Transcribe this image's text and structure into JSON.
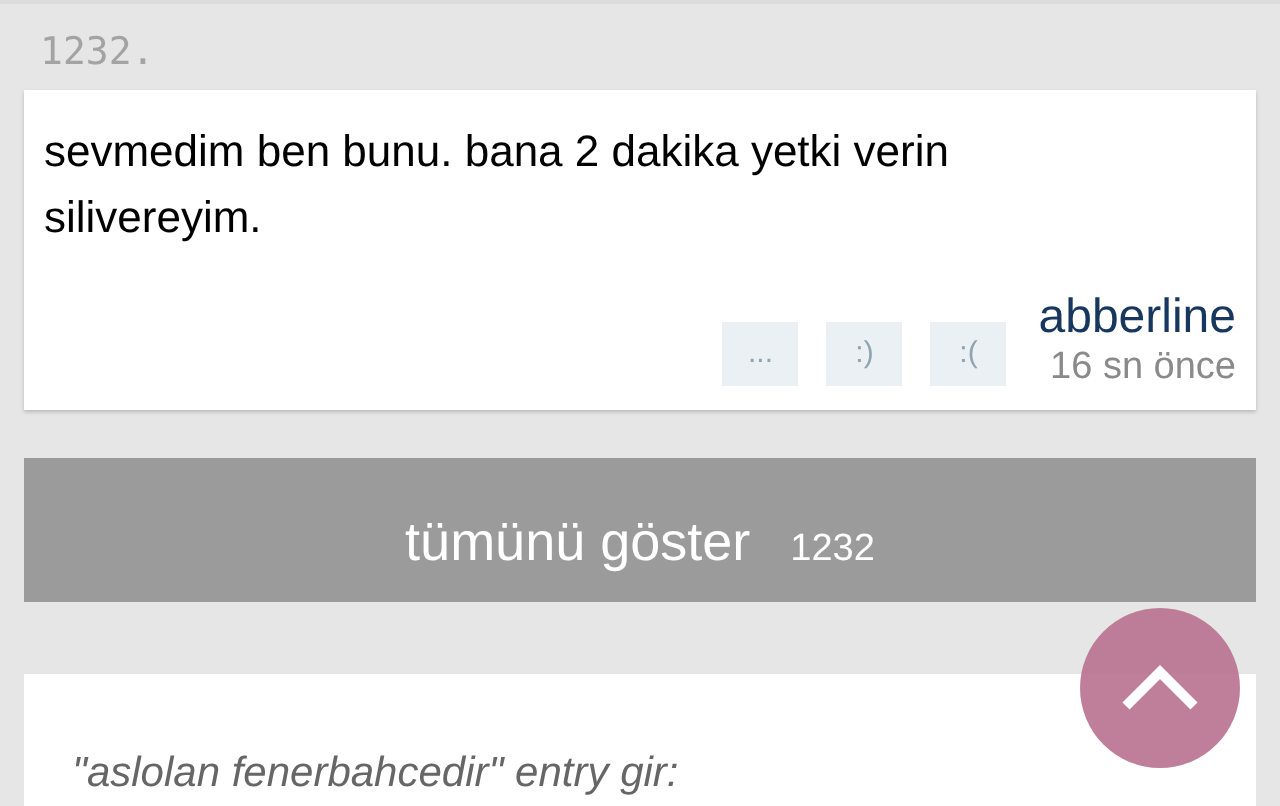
{
  "entry": {
    "number": "1232.",
    "text": "sevmedim ben bunu. bana 2 dakika yetki verin silivereyim.",
    "actions": [
      "...",
      ":)",
      ":("
    ],
    "author": "abberline",
    "time": "16 sn önce"
  },
  "show_all": {
    "label": "tümünü göster",
    "count": "1232"
  },
  "compose": {
    "prompt": "\"aslolan fenerbahcedir\" entry gir:"
  }
}
